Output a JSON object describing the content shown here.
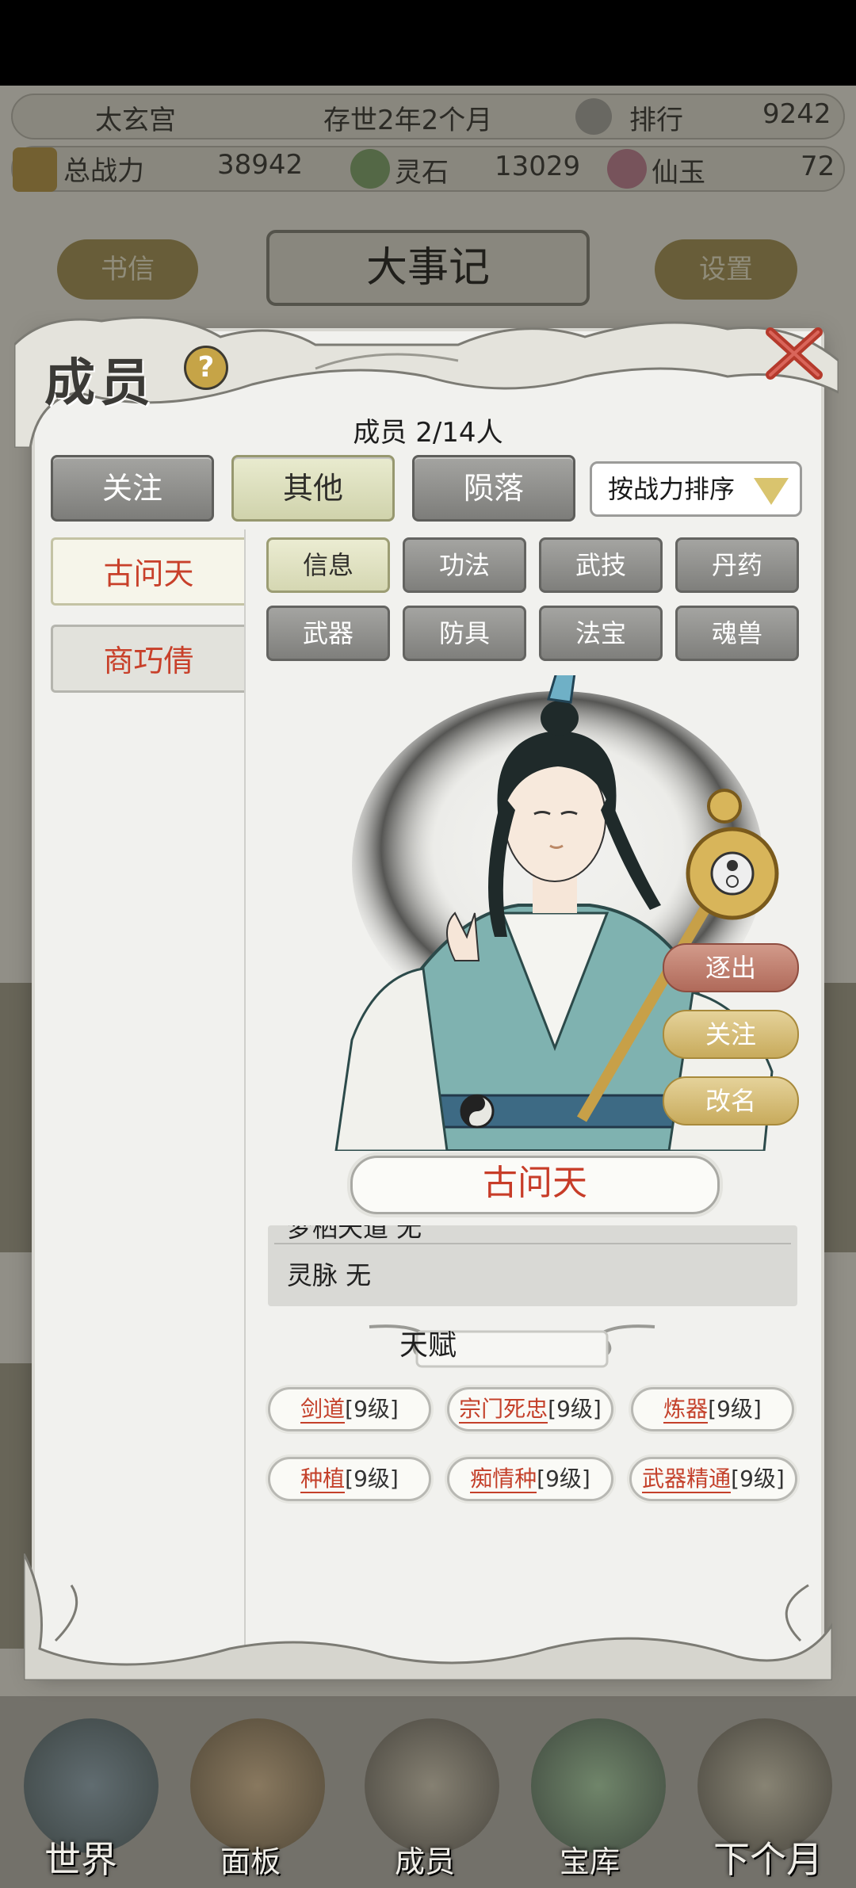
{
  "hud": {
    "sect_name": "太玄宫",
    "age": "存世2年2个月",
    "rank_label": "排行",
    "rank_value": "9242",
    "power_label": "总战力",
    "power_value": "38942",
    "stone_label": "灵石",
    "stone_value": "13029",
    "jade_label": "仙玉",
    "jade_value": "72"
  },
  "background_buttons": {
    "letters": "书信",
    "events": "大事记",
    "settings": "设置"
  },
  "modal": {
    "title": "成员",
    "count_label": "成员 2/14人",
    "tabs": [
      {
        "label": "关注"
      },
      {
        "label": "其他"
      },
      {
        "label": "陨落"
      }
    ],
    "sort_label": "按战力排序",
    "members": [
      {
        "name": "古问天"
      },
      {
        "name": "商巧倩"
      }
    ],
    "sub_tabs": [
      {
        "label": "信息"
      },
      {
        "label": "功法"
      },
      {
        "label": "武技"
      },
      {
        "label": "丹药"
      },
      {
        "label": "武器"
      },
      {
        "label": "防具"
      },
      {
        "label": "法宝"
      },
      {
        "label": "魂兽"
      }
    ],
    "actions": {
      "expel": "逐出",
      "follow": "关注",
      "rename": "改名"
    },
    "character_name": "古问天",
    "info_rows": [
      {
        "label": "梦栖天道 无"
      },
      {
        "label": "灵脉 无"
      }
    ],
    "talent_title": "天赋",
    "talents": [
      {
        "name": "剑道",
        "level": "[9级]"
      },
      {
        "name": "宗门死忠",
        "level": "[9级]"
      },
      {
        "name": "炼器",
        "level": "[9级]"
      },
      {
        "name": "种植",
        "level": "[9级]"
      },
      {
        "name": "痴情种",
        "level": "[9级]"
      },
      {
        "name": "武器精通",
        "level": "[9级]"
      }
    ]
  },
  "bottom_nav": [
    {
      "label": "世界"
    },
    {
      "label": "面板"
    },
    {
      "label": "成员"
    },
    {
      "label": "宝库"
    },
    {
      "label": "下个月"
    }
  ],
  "colors": {
    "accent_red": "#c73c28",
    "gold": "#c6a447",
    "panel": "#f1f1ee"
  }
}
